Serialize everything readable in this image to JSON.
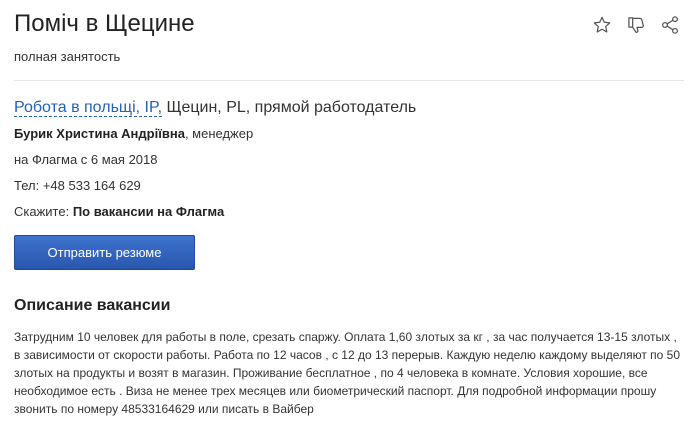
{
  "vacancy": {
    "title": "Поміч в Щецине",
    "employment_type": "полная занятость"
  },
  "actions": {
    "favorite_icon": "star-icon",
    "dislike_icon": "thumbs-down-icon",
    "share_icon": "share-icon"
  },
  "company": {
    "name": "Робота в польщі, IP,",
    "details": " Щецин, PL, прямой работодатель"
  },
  "contact": {
    "name": "Бурик Христина Андріївна",
    "role": ", менеджер",
    "since": "на Флагма с 6 мая 2018",
    "phone": "Тел: +48 533 164 629",
    "say_label": "Скажите: ",
    "say_value": "По вакансии на Флагма"
  },
  "apply_button": {
    "label": "Отправить резюме"
  },
  "description": {
    "heading": "Описание вакансии",
    "text": "Затрудним 10 человек для работы в поле, срезать спаржу. Оплата 1,60 злотых за кг , за час получается 13-15 злотых , в зависимости от скорости работы. Работа по 12 часов , с 12 до 13 перерыв. Каждую неделю каждому выделяют по 50 злотых на продукты и возят в магазин. Проживание бесплатное , по 4 человека в комнате. Условия хорошие, все необходимое есть . Виза не менее трех месяцев или биометрический паспорт. Для подробной информации прошу звонить по номеру 48533164629 или писать в Вайбер"
  },
  "colors": {
    "link": "#2760b8",
    "button": "#2f62bf",
    "icon": "#555555"
  }
}
